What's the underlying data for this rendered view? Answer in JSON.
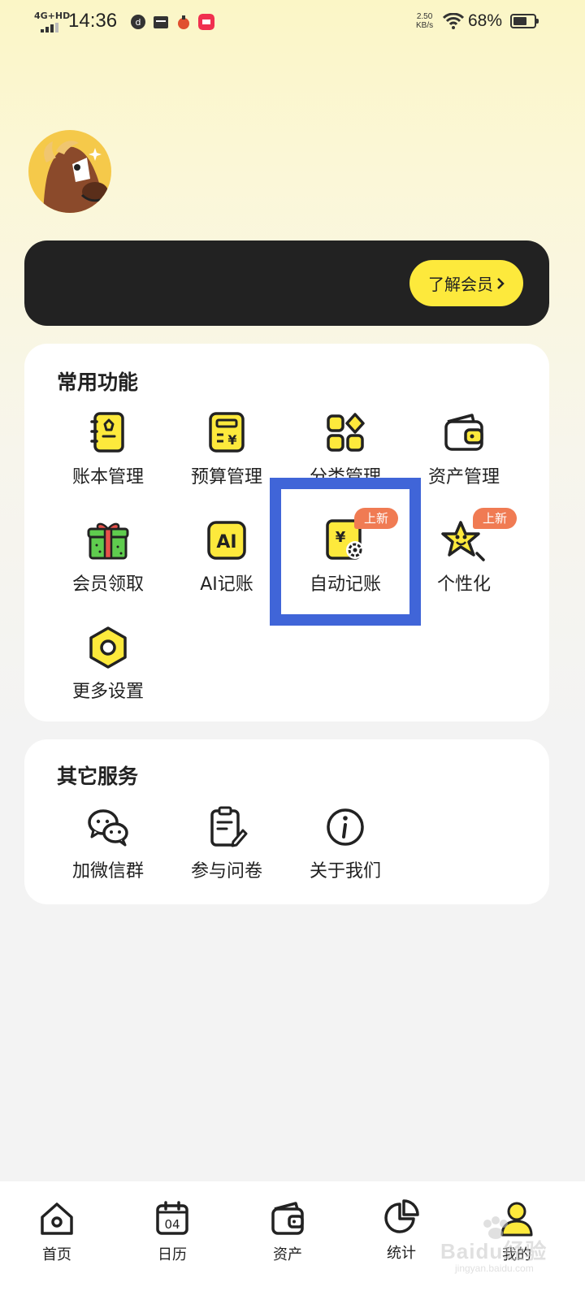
{
  "status_bar": {
    "network": "4G+HD",
    "time": "14:36",
    "speed_value": "2.50",
    "speed_unit": "KB/s",
    "battery_text": "68%",
    "battery_level": 0.68
  },
  "profile": {
    "avatar_icon": "horse-avatar"
  },
  "membership": {
    "button_label": "了解会员"
  },
  "common_functions": {
    "title": "常用功能",
    "items": [
      {
        "label": "账本管理",
        "icon": "ledger-book-icon"
      },
      {
        "label": "预算管理",
        "icon": "budget-calculator-icon"
      },
      {
        "label": "分类管理",
        "icon": "category-grid-icon"
      },
      {
        "label": "资产管理",
        "icon": "wallet-icon"
      },
      {
        "label": "会员领取",
        "icon": "gift-box-icon"
      },
      {
        "label": "AI记账",
        "icon": "ai-icon"
      },
      {
        "label": "自动记账",
        "icon": "auto-bookkeeping-icon",
        "badge": "上新"
      },
      {
        "label": "个性化",
        "icon": "star-personalize-icon",
        "badge": "上新"
      },
      {
        "label": "更多设置",
        "icon": "settings-hexagon-icon"
      }
    ]
  },
  "other_services": {
    "title": "其它服务",
    "items": [
      {
        "label": "加微信群",
        "icon": "wechat-group-icon"
      },
      {
        "label": "参与问卷",
        "icon": "survey-icon"
      },
      {
        "label": "关于我们",
        "icon": "info-icon"
      }
    ]
  },
  "bottom_nav": {
    "items": [
      {
        "label": "首页",
        "icon": "home-icon"
      },
      {
        "label": "日历",
        "icon": "calendar-icon",
        "icon_text": "04"
      },
      {
        "label": "资产",
        "icon": "wallet-icon"
      },
      {
        "label": "统计",
        "icon": "pie-chart-icon"
      },
      {
        "label": "我的",
        "icon": "profile-icon",
        "active": true
      }
    ]
  },
  "watermark": {
    "text": "Baidu经验",
    "sub": "jingyan.baidu.com"
  },
  "colors": {
    "accent_yellow": "#fde93c",
    "banner_dark": "#222222",
    "badge_orange": "#f07b53",
    "highlight_blue": "#4065d8"
  }
}
